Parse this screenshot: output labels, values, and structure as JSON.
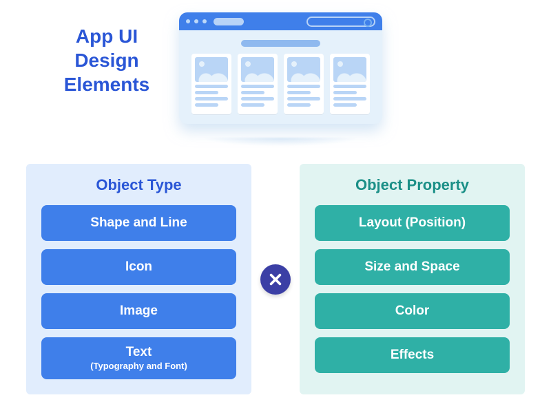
{
  "title": "App UI\nDesign\nElements",
  "panels": {
    "left": {
      "title": "Object Type",
      "items": [
        {
          "label": "Shape and Line"
        },
        {
          "label": "Icon"
        },
        {
          "label": "Image"
        },
        {
          "label": "Text",
          "sub": "(Typography and Font)"
        }
      ]
    },
    "right": {
      "title": "Object Property",
      "items": [
        {
          "label": "Layout (Position)"
        },
        {
          "label": "Size and Space"
        },
        {
          "label": "Color"
        },
        {
          "label": "Effects"
        }
      ]
    }
  },
  "operator": "multiply",
  "colors": {
    "blue": "#3f7fea",
    "teal": "#2fb0a6",
    "title": "#2a56d6",
    "badge": "#3b3fa5"
  }
}
